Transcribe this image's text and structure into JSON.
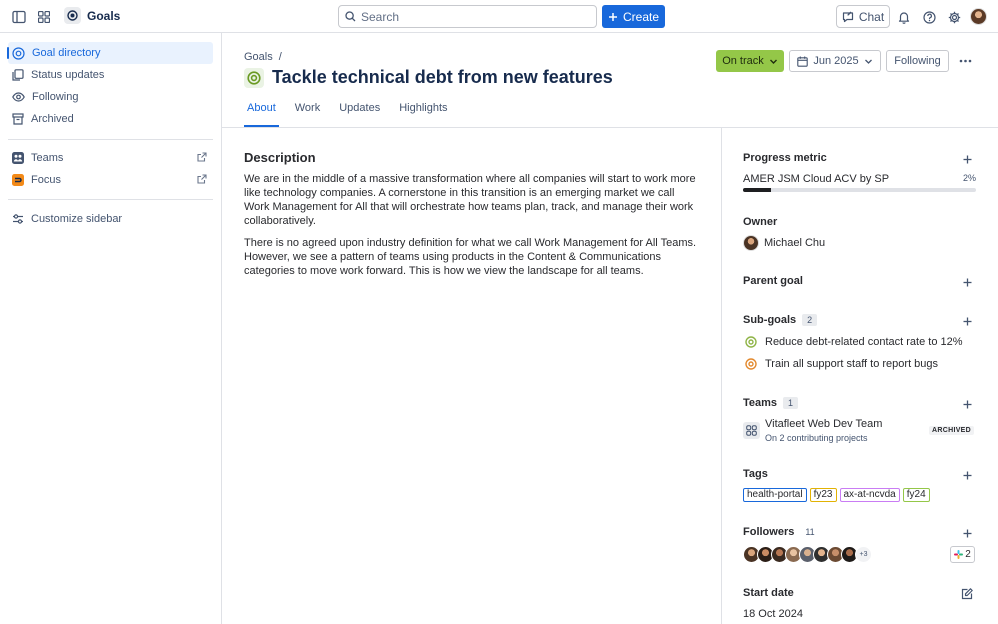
{
  "topbar": {
    "app_name": "Goals",
    "search_placeholder": "Search",
    "create_label": "Create",
    "chat_label": "Chat"
  },
  "sidebar": {
    "items": [
      {
        "label": "Goal directory",
        "icon": "target-icon"
      },
      {
        "label": "Status updates",
        "icon": "copy-icon"
      },
      {
        "label": "Following",
        "icon": "eye-icon"
      },
      {
        "label": "Archived",
        "icon": "archive-icon"
      }
    ],
    "apps": [
      {
        "label": "Teams",
        "icon": "teams-app-icon"
      },
      {
        "label": "Focus",
        "icon": "focus-app-icon"
      }
    ],
    "customize_label": "Customize sidebar"
  },
  "header": {
    "breadcrumb": "Goals",
    "breadcrumb_sep": "/",
    "title": "Tackle technical debt from new features",
    "status_label": "On track",
    "date_label": "Jun 2025",
    "following_label": "Following"
  },
  "tabs": [
    {
      "label": "About",
      "active": true
    },
    {
      "label": "Work",
      "active": false
    },
    {
      "label": "Updates",
      "active": false
    },
    {
      "label": "Highlights",
      "active": false
    }
  ],
  "description": {
    "heading": "Description",
    "paragraphs": [
      "We are in the middle of a massive transformation where all companies will start to work more like technology companies. A cornerstone in this transition is an emerging market we call Work Management for All that will orchestrate how teams plan, track, and manage their work collaboratively.",
      "There is no agreed upon industry definition for what we call Work Management for All Teams. However, we see a pattern of teams using products in the Content & Communications categories to move work forward. This is how we view the landscape for all teams."
    ]
  },
  "right_panel": {
    "progress": {
      "heading": "Progress metric",
      "metric_name": "AMER JSM Cloud ACV by SP",
      "percent_label": "2%",
      "progress_fraction": 0.12
    },
    "owner": {
      "heading": "Owner",
      "name": "Michael Chu"
    },
    "parent_goal": {
      "heading": "Parent goal"
    },
    "sub_goals": {
      "heading": "Sub-goals",
      "count": "2",
      "items": [
        {
          "label": "Reduce debt-related contact rate to 12%",
          "color": "#8fb447"
        },
        {
          "label": "Train all support staff to report bugs",
          "color": "#e38a2f"
        }
      ]
    },
    "teams": {
      "heading": "Teams",
      "count": "1",
      "team_name": "Vitafleet Web Dev Team",
      "team_sub": "On 2 contributing projects",
      "badge": "ARCHIVED"
    },
    "tags": {
      "heading": "Tags",
      "items": [
        {
          "label": "health-portal",
          "color": "#1868db"
        },
        {
          "label": "fy23",
          "color": "#e2b203"
        },
        {
          "label": "ax-at-ncvda",
          "color": "#c97cf4"
        },
        {
          "label": "fy24",
          "color": "#94c748"
        }
      ]
    },
    "followers": {
      "heading": "Followers",
      "count": "11",
      "more_label": "+3",
      "slack_count": "2"
    },
    "start_date": {
      "heading": "Start date",
      "value": "18 Oct 2024"
    }
  },
  "colors": {
    "accent": "#1868db",
    "on_track": "#94c748"
  }
}
